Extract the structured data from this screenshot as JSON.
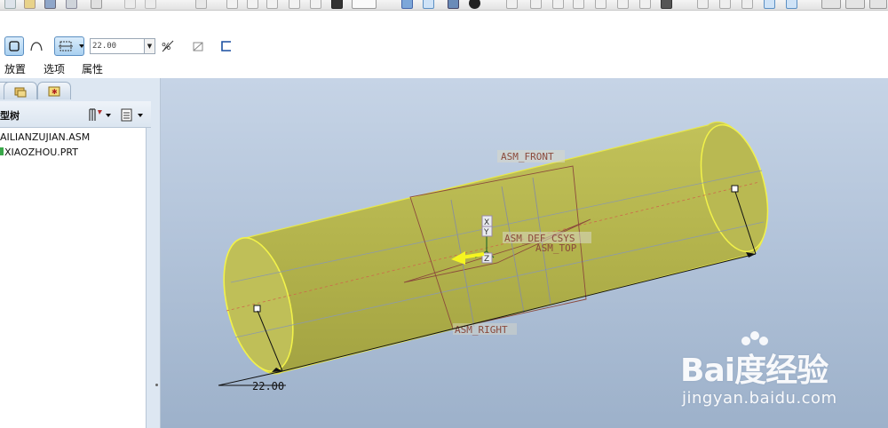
{
  "dashboard": {
    "depth_value": "22.00",
    "tabs": [
      "放置",
      "选项",
      "属性"
    ]
  },
  "model_tree": {
    "title": "型树",
    "items": [
      "AILIANZUJIAN.ASM",
      "XIAOZHOU.PRT"
    ]
  },
  "viewport": {
    "datum_labels": [
      "ASM_FRONT",
      "ASM_DEF_CSYS",
      "ASM_TOP",
      "ASM_RIGHT"
    ],
    "csys_axes": [
      "X",
      "Y",
      "Z"
    ],
    "dimension_value": "22.00",
    "cylinder_color": "#b5b54e",
    "edge_color": "#f2f24a"
  },
  "watermark": {
    "logo": "Bai度经验",
    "url": "jingyan.baidu.com"
  },
  "colors": {
    "active_button": "#a9d0f0",
    "panel_bg": "#dde7f2",
    "viewport_top": "#c6d4e6",
    "viewport_bottom": "#9db1ca",
    "datum_color": "#8b4a3c"
  }
}
